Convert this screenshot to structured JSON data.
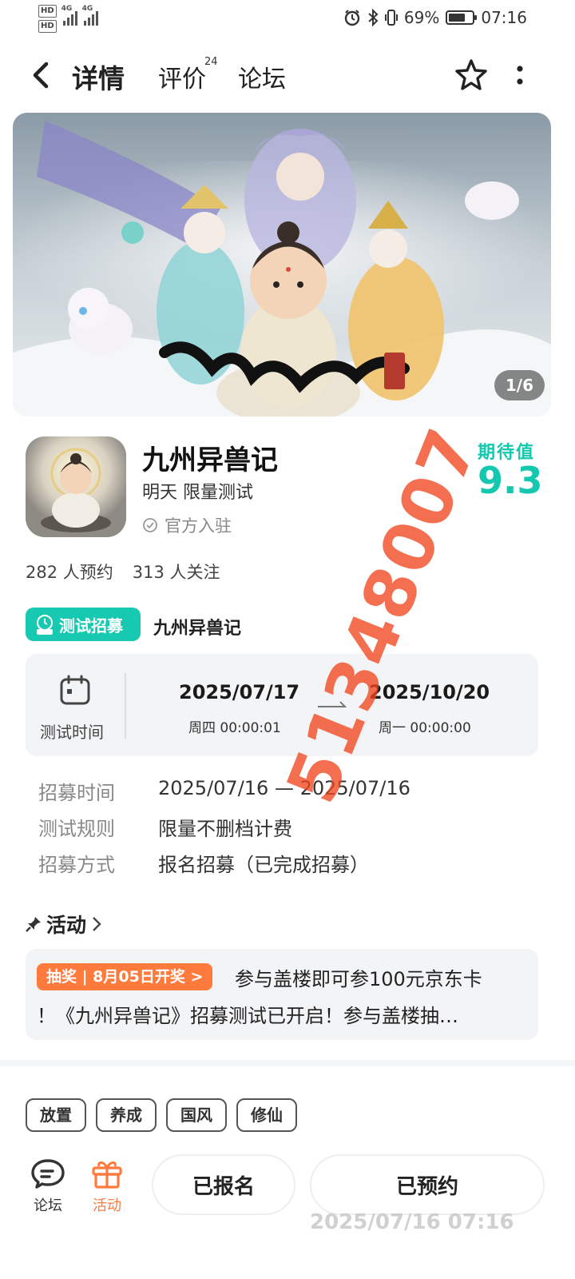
{
  "status_bar": {
    "hd1": "HD",
    "hd2": "HD",
    "sim1": "4G",
    "sim2": "4G",
    "battery": "69%",
    "battery_level": 0.69,
    "time": "07:16"
  },
  "nav": {
    "tab_detail": "详情",
    "tab_review": "评价",
    "review_count": "24",
    "tab_forum": "论坛"
  },
  "banner": {
    "counter": "1/6",
    "title_art": "九州异兽记"
  },
  "game": {
    "name": "九州异兽记",
    "subtitle": "明天 限量测试",
    "official": "官方入驻",
    "expect_label": "期待值",
    "expect_value": "9.3",
    "reservations": "282 人预约",
    "follows": "313 人关注"
  },
  "recruit": {
    "badge": "测试招募",
    "name": "九州异兽记",
    "time_label": "测试时间",
    "start_date": "2025/07/17",
    "start_time": "周四  00:00:01",
    "end_date": "2025/10/20",
    "end_time": "周一  00:00:00",
    "rows": [
      {
        "key": "招募时间",
        "value": "2025/07/16 — 2025/07/16"
      },
      {
        "key": "测试规则",
        "value": "限量不删档计费"
      },
      {
        "key": "招募方式",
        "value": "报名招募（已完成招募）"
      }
    ]
  },
  "activity": {
    "title": "活动",
    "lottery_tag": "抽奖 | 8月05日开奖 >",
    "line1": "参与盖楼即可参100元京东卡",
    "line2": "！《九州异兽记》招募测试已开启！参与盖楼抽…"
  },
  "tags": [
    "放置",
    "养成",
    "国风",
    "修仙"
  ],
  "bottom": {
    "forum": "论坛",
    "activity": "活动",
    "signed_up": "已报名",
    "reserved": "已预约"
  },
  "watermarks": {
    "number": "51348007",
    "timestamp": "2025/07/16 07:16"
  },
  "colors": {
    "accent": "#16c9b0",
    "orange": "#ff7a3d"
  }
}
